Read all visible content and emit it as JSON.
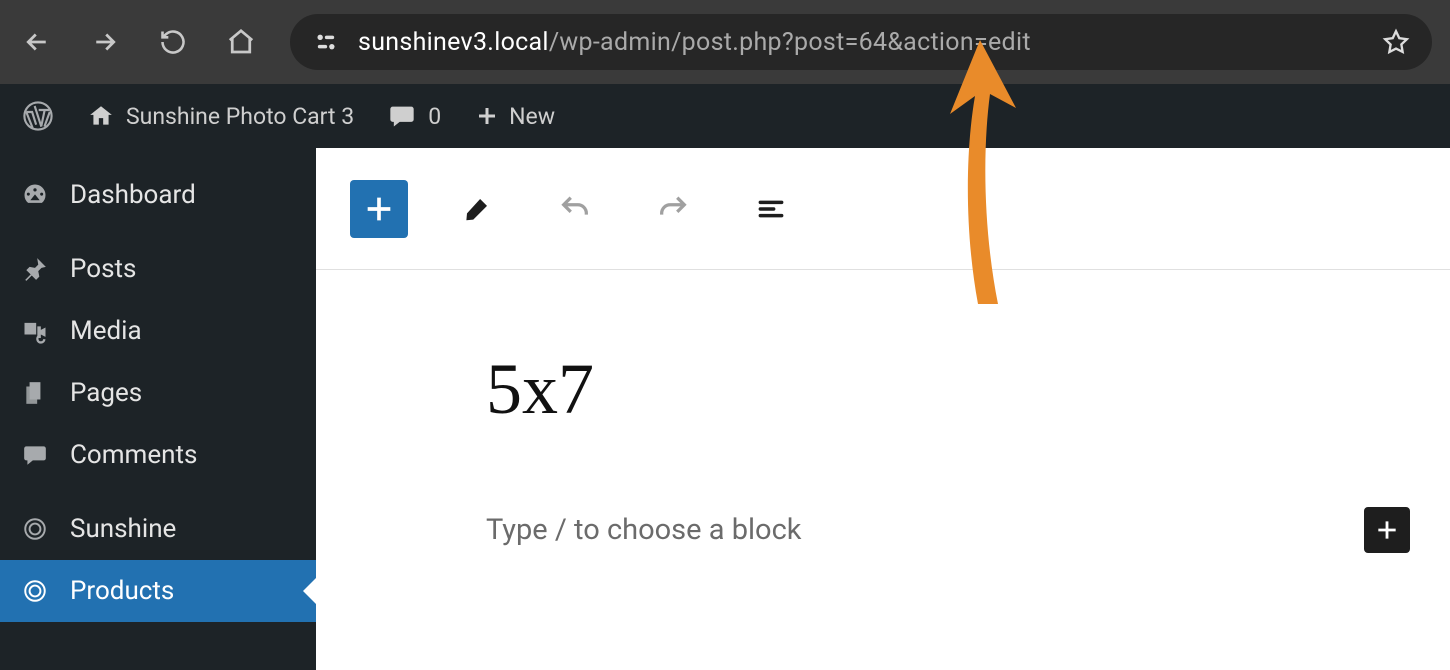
{
  "browser": {
    "url_domain": "sunshinev3.local",
    "url_path": "/wp-admin/post.php?post=64&action=edit"
  },
  "adminbar": {
    "site_name": "Sunshine Photo Cart 3",
    "comments_count": "0",
    "new_label": "New"
  },
  "sidebar": {
    "dashboard": "Dashboard",
    "posts": "Posts",
    "media": "Media",
    "pages": "Pages",
    "comments": "Comments",
    "sunshine": "Sunshine",
    "products": "Products"
  },
  "editor": {
    "title": "5x7",
    "placeholder": "Type / to choose a block"
  },
  "annotation": {
    "arrow_color": "#e98b2a"
  }
}
